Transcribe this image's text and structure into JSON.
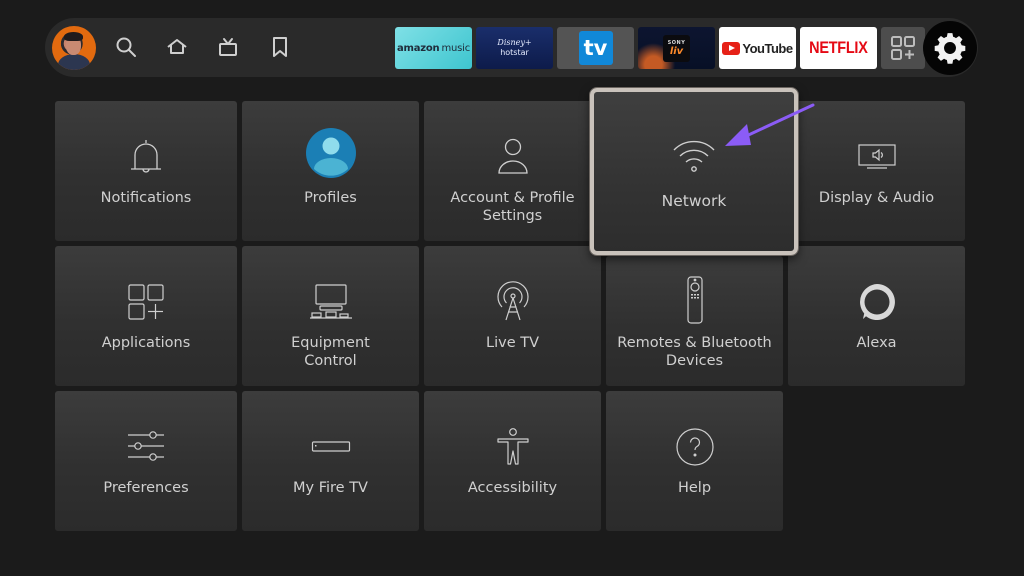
{
  "topbar": {
    "profile": {
      "label": "User profile"
    },
    "nav": [
      {
        "id": "search",
        "icon": "search-icon"
      },
      {
        "id": "home",
        "icon": "home-icon"
      },
      {
        "id": "live-tv",
        "icon": "tv-icon"
      },
      {
        "id": "watchlist",
        "icon": "bookmark-icon"
      }
    ],
    "apps": {
      "amazon_music": {
        "brand": "amazon",
        "suffix": "music"
      },
      "hotstar": {
        "line1": "Disney+",
        "line2": "hotstar"
      },
      "tv": {
        "label": "tv"
      },
      "sonyliv": {
        "line1": "SONY",
        "line2": "liv"
      },
      "youtube": {
        "label": "YouTube"
      },
      "netflix": {
        "label": "NETFLIX"
      }
    },
    "add_apps": {
      "icon": "apps-add-icon"
    },
    "settings": {
      "icon": "gear-icon",
      "selected": true
    }
  },
  "settings_grid": {
    "focused": "Network",
    "items": [
      {
        "label": "Notifications",
        "icon": "bell-icon"
      },
      {
        "label": "Profiles",
        "icon": "profile-icon"
      },
      {
        "label": "Account & Profile Settings",
        "line1": "Account & Profile",
        "line2": "Settings",
        "icon": "person-icon"
      },
      {
        "label": "Network",
        "icon": "wifi-icon"
      },
      {
        "label": "Display & Audio",
        "icon": "display-audio-icon"
      },
      {
        "label": "Applications",
        "icon": "applications-icon"
      },
      {
        "label": "Equipment Control",
        "line1": "Equipment",
        "line2": "Control",
        "icon": "equipment-icon"
      },
      {
        "label": "Live TV",
        "icon": "antenna-icon"
      },
      {
        "label": "Remotes & Bluetooth Devices",
        "line1": "Remotes & Bluetooth",
        "line2": "Devices",
        "icon": "remote-icon"
      },
      {
        "label": "Alexa",
        "icon": "alexa-icon"
      },
      {
        "label": "Preferences",
        "icon": "sliders-icon"
      },
      {
        "label": "My Fire TV",
        "icon": "fire-tv-device-icon"
      },
      {
        "label": "Accessibility",
        "icon": "accessibility-icon"
      },
      {
        "label": "Help",
        "icon": "help-icon"
      }
    ]
  },
  "annotation": {
    "arrow_color": "#8b5cf6",
    "points_to": "Network"
  },
  "colors": {
    "background": "#1b1b1b",
    "topbar": "#2a2a2a",
    "tile": "#333333",
    "focus_border": "#c9c2bb",
    "text": "#d0d0d0"
  }
}
